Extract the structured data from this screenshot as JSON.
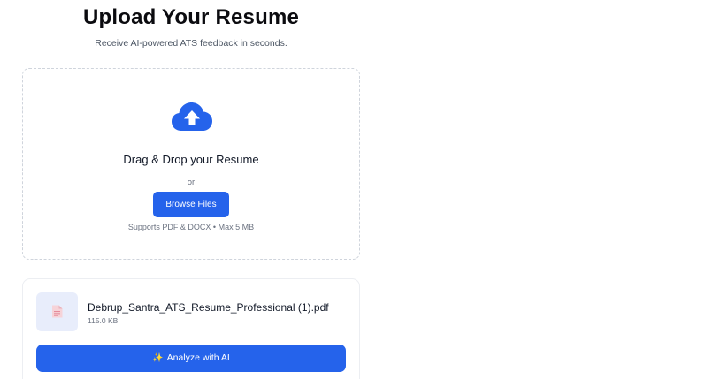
{
  "header": {
    "title": "Upload Your Resume",
    "subtitle": "Receive AI-powered ATS feedback in seconds."
  },
  "dropzone": {
    "icon": "cloud-upload-icon",
    "title": "Drag & Drop your Resume",
    "or_text": "or",
    "browse_label": "Browse Files",
    "supports_text": "Supports PDF & DOCX • Max 5 MB"
  },
  "file": {
    "icon": "document-icon",
    "name": "Debrup_Santra_ATS_Resume_Professional (1).pdf",
    "size": "115.0 KB"
  },
  "actions": {
    "analyze_icon": "sparkles-icon",
    "analyze_label": "Analyze with AI"
  },
  "colors": {
    "accent": "#2563eb",
    "thumb_bg": "#e8edfb"
  }
}
